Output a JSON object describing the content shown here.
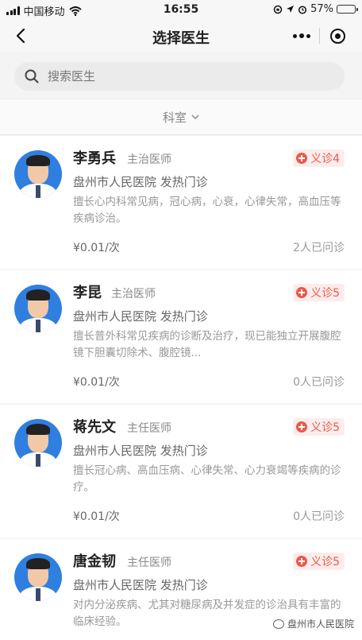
{
  "status_bar": {
    "carrier": "中国移动",
    "time": "16:55",
    "battery": "57%",
    "battery_level": 0.57
  },
  "nav": {
    "title": "选择医生"
  },
  "search": {
    "placeholder": "搜索医生"
  },
  "filter": {
    "department_label": "科室"
  },
  "doctors": [
    {
      "name": "李勇兵",
      "rank": "主治医师",
      "badge": "义诊4",
      "hospital": "盘州市人民医院 发热门诊",
      "description": "擅长心内科常见病，冠心病，心衰，心律失常，高血压等疾病诊治。",
      "price": "¥0.01/次",
      "consult_count": "2人已问诊"
    },
    {
      "name": "李昆",
      "rank": "主治医师",
      "badge": "义诊5",
      "hospital": "盘州市人民医院 发热门诊",
      "description": "擅长普外科常见疾病的诊断及治疗，现已能独立开展腹腔镜下胆囊切除术、腹腔镜...",
      "price": "¥0.01/次",
      "consult_count": "0人已问诊"
    },
    {
      "name": "蒋先文",
      "rank": "主任医师",
      "badge": "义诊5",
      "hospital": "盘州市人民医院 发热门诊",
      "description": "擅长冠心病、高血压病、心律失常、心力衰竭等疾病的诊疗。",
      "price": "¥0.01/次",
      "consult_count": "0人已问诊"
    },
    {
      "name": "唐金韧",
      "rank": "主任医师",
      "badge": "义诊5",
      "hospital": "盘州市人民医院 发热门诊",
      "description": "对内分泌疾病、尤其对糖尿病及并发症的诊治具有丰富的临床经验。",
      "price": "",
      "consult_count": ""
    }
  ],
  "watermark": "盘州市人民医院",
  "colors": {
    "accent_red": "#e65a4b",
    "avatar_blue": "#2f7fe0"
  }
}
